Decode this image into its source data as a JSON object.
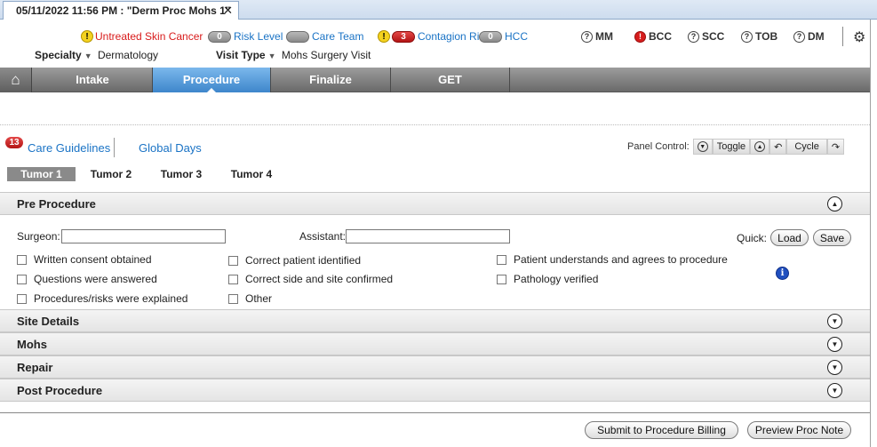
{
  "window": {
    "tab_title": "05/11/2022 11:56 PM : \"Derm Proc Mohs 1\"",
    "close_glyph": "✕"
  },
  "alerts": [
    {
      "label": "Untreated Skin Cancer",
      "badge": "!",
      "kind": "warning"
    },
    {
      "label": "Risk Level",
      "badge": "0",
      "kind": "pill"
    },
    {
      "label": "Care Team",
      "badge": "",
      "kind": "pill"
    },
    {
      "label": "Contagion Risk",
      "badge": "3",
      "kind": "pill-red"
    },
    {
      "label": "HCC",
      "badge": "0",
      "kind": "pill"
    }
  ],
  "quick_indicators": [
    {
      "label": "MM",
      "icon": "?"
    },
    {
      "label": "BCC",
      "icon": "!"
    },
    {
      "label": "SCC",
      "icon": "?"
    },
    {
      "label": "TOB",
      "icon": "?"
    },
    {
      "label": "DM",
      "icon": "?"
    }
  ],
  "settings_icon": "⚙",
  "specialty": {
    "label": "Specialty",
    "value": "Dermatology"
  },
  "visit_type": {
    "label": "Visit Type",
    "value": "Mohs Surgery Visit"
  },
  "nav": {
    "home_icon": "⌂",
    "items": [
      "Intake",
      "Procedure",
      "Finalize",
      "GET"
    ],
    "active": "Procedure"
  },
  "care": {
    "badge": "13",
    "guidelines_label": "Care Guidelines",
    "global_days_label": "Global Days"
  },
  "panel_control": {
    "label": "Panel Control:",
    "toggle_label": "Toggle",
    "cycle_label": "Cycle",
    "down_glyph": "▼",
    "up_glyph": "▲",
    "back_glyph": "↶",
    "fwd_glyph": "↷"
  },
  "tumors": [
    "Tumor 1",
    "Tumor 2",
    "Tumor 3",
    "Tumor 4"
  ],
  "sections": {
    "pre_procedure": "Pre Procedure",
    "site_details": "Site Details",
    "mohs": "Mohs",
    "repair": "Repair",
    "post_procedure": "Post Procedure",
    "expanded_glyph": "▲",
    "collapsed_glyph": "▼"
  },
  "pre_procedure": {
    "surgeon_label": "Surgeon:",
    "surgeon_value": "",
    "assistant_label": "Assistant:",
    "assistant_value": "",
    "quick_label": "Quick:",
    "load_label": "Load",
    "save_label": "Save",
    "info_glyph": "i",
    "checklist": [
      "Written consent obtained",
      "Questions were answered",
      "Procedures/risks were explained",
      "Correct patient identified",
      "Correct side and site confirmed",
      "Other",
      "Patient understands and agrees to procedure",
      "Pathology verified"
    ]
  },
  "footer": {
    "submit_label": "Submit to Procedure Billing",
    "preview_label": "Preview Proc Note"
  },
  "colors": {
    "accent": "#3e86cb",
    "link": "#1a73c5",
    "danger": "#d81b1b"
  }
}
